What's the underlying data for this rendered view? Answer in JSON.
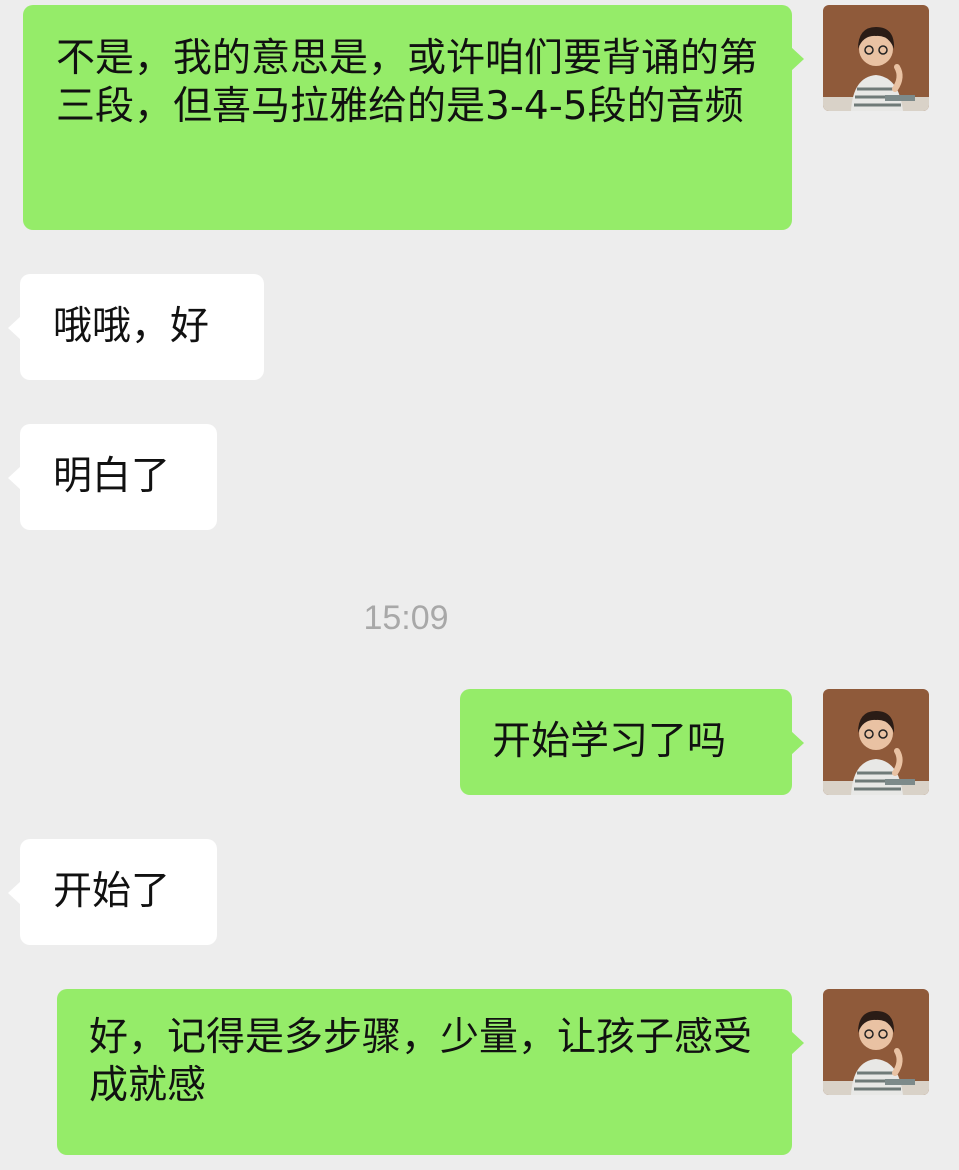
{
  "colors": {
    "background": "#ededed",
    "outgoing_bubble": "#95ec69",
    "incoming_bubble": "#ffffff",
    "timestamp_text": "#a8a8a8"
  },
  "avatar_icon": "user-photo-avatar",
  "messages": [
    {
      "direction": "out",
      "text": "不是，我的意思是，或许咱们要背诵的第三段，但喜马拉雅给的是3-4-5段的音频"
    },
    {
      "direction": "in",
      "text": "哦哦，好"
    },
    {
      "direction": "in",
      "text": "明白了"
    },
    {
      "direction": "out",
      "text": "开始学习了吗"
    },
    {
      "direction": "in",
      "text": "开始了"
    },
    {
      "direction": "out",
      "text": "好，记得是多步骤，少量，让孩子感受成就感"
    }
  ],
  "timestamp": "15:09"
}
